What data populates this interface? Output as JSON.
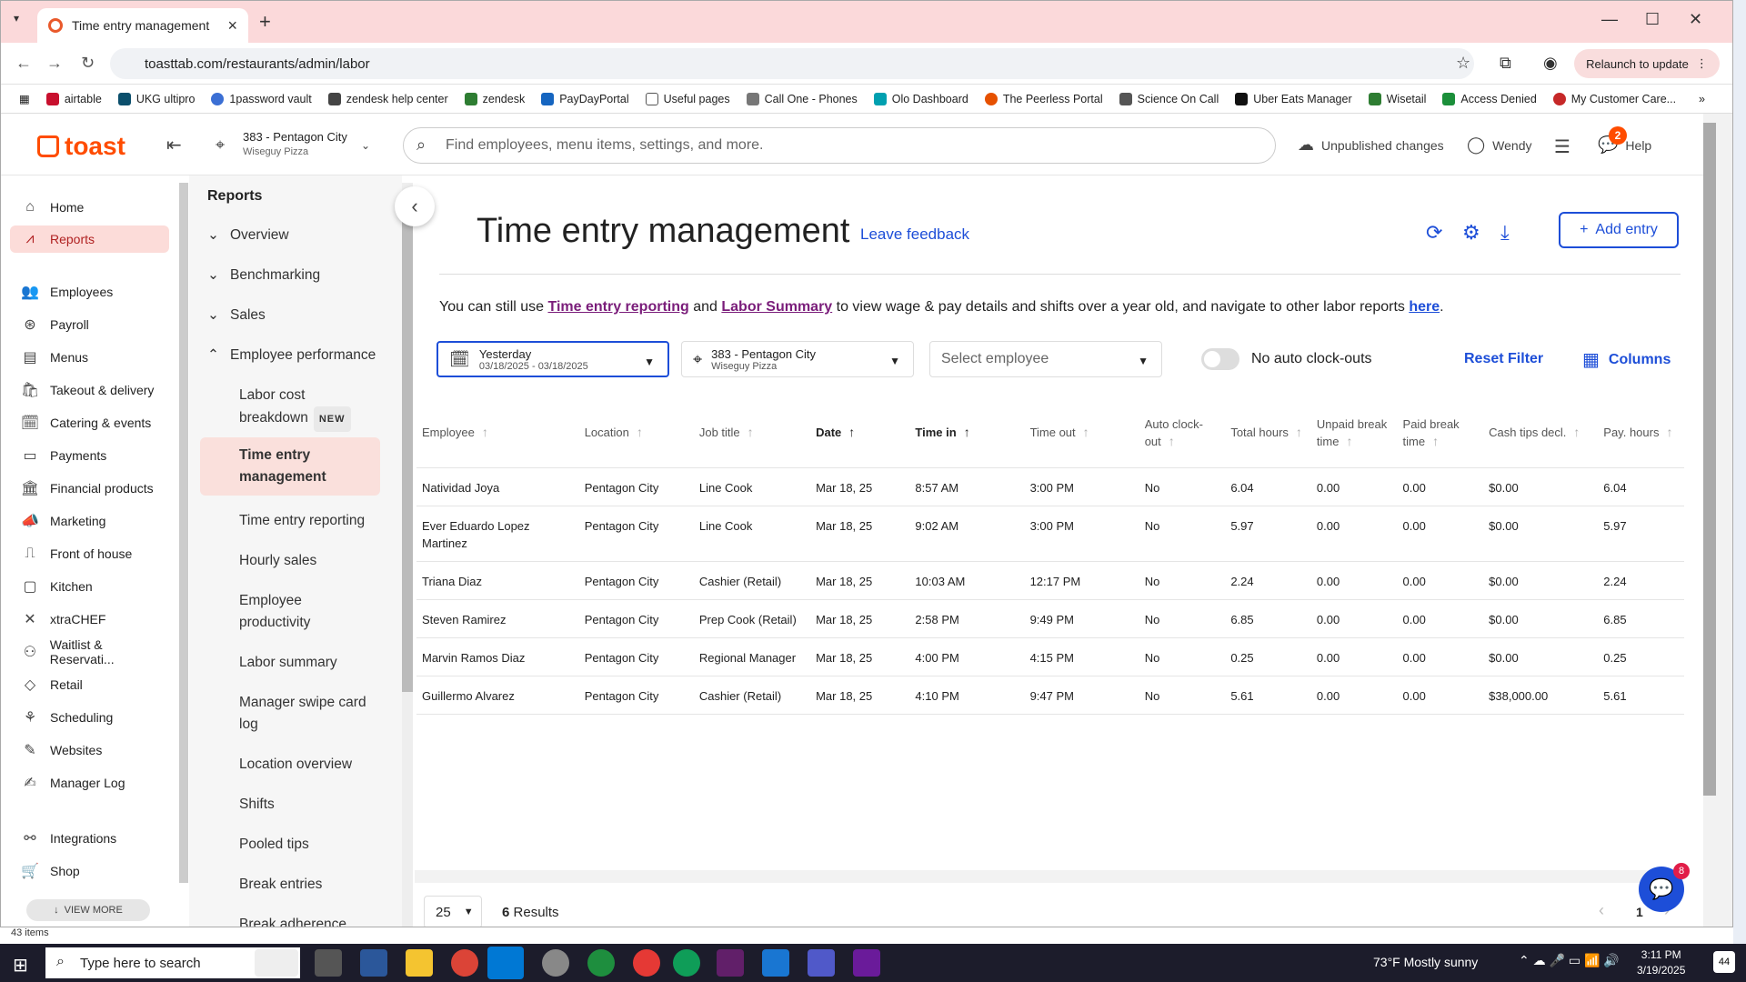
{
  "browser": {
    "tab_title": "Time entry management",
    "url": "toasttab.com/restaurants/admin/labor",
    "relaunch_label": "Relaunch to update",
    "bookmarks": [
      "airtable",
      "UKG ultipro",
      "1password vault",
      "zendesk help center",
      "zendesk",
      "PayDayPortal",
      "Useful pages",
      "Call One - Phones",
      "Olo Dashboard",
      "The Peerless Portal",
      "Science On Call",
      "Uber Eats Manager",
      "Wisetail",
      "Access Denied",
      "My Customer Care..."
    ]
  },
  "app": {
    "logo": "toast",
    "location_name": "383 - Pentagon City",
    "location_sub": "Wiseguy Pizza",
    "search_placeholder": "Find employees, menu items, settings, and more.",
    "unpublished": "Unpublished changes",
    "user": "Wendy",
    "help": "Help",
    "help_badge": "2"
  },
  "sidebar": {
    "items": [
      "Home",
      "Reports",
      "Employees",
      "Payroll",
      "Menus",
      "Takeout & delivery",
      "Catering & events",
      "Payments",
      "Financial products",
      "Marketing",
      "Front of house",
      "Kitchen",
      "xtraCHEF",
      "Waitlist & Reservati...",
      "Retail",
      "Scheduling",
      "Websites",
      "Manager Log",
      "Integrations",
      "Shop"
    ],
    "view_more": "VIEW MORE"
  },
  "subnav": {
    "heading": "Reports",
    "groups": [
      "Overview",
      "Benchmarking",
      "Sales",
      "Employee performance"
    ],
    "items": [
      "Labor cost breakdown",
      "Time entry management",
      "Time entry reporting",
      "Hourly sales",
      "Employee productivity",
      "Labor summary",
      "Manager swipe card log",
      "Location overview",
      "Shifts",
      "Pooled tips",
      "Break entries",
      "Break adherence"
    ],
    "new_badge": "NEW"
  },
  "main": {
    "title": "Time entry management",
    "feedback": "Leave feedback",
    "add_entry": "Add entry",
    "info_pre": "You can still use ",
    "info_link1": "Time entry reporting",
    "info_and": " and ",
    "info_link2": "Labor Summary",
    "info_mid": " to view wage & pay details and shifts over a year old, and navigate to other labor reports ",
    "info_link3": "here",
    "info_end": ".",
    "date_label": "Yesterday",
    "date_range": "03/18/2025 - 03/18/2025",
    "filter_location": "383 - Pentagon City",
    "filter_location_sub": "Wiseguy Pizza",
    "employee_placeholder": "Select employee",
    "toggle_label": "No auto clock-outs",
    "reset": "Reset Filter",
    "columns": "Columns",
    "per_page": "25",
    "results_count": "6",
    "results_label": "Results",
    "page": "1"
  },
  "table": {
    "headers": [
      "Employee",
      "Location",
      "Job title",
      "Date",
      "Time in",
      "Time out",
      "Auto clock-out",
      "Total hours",
      "Unpaid break time",
      "Paid break time",
      "Cash tips decl.",
      "Pay. hours"
    ],
    "rows": [
      [
        "Natividad Joya",
        "Pentagon City",
        "Line Cook",
        "Mar 18, 25",
        "8:57 AM",
        "3:00 PM",
        "No",
        "6.04",
        "0.00",
        "0.00",
        "$0.00",
        "6.04"
      ],
      [
        "Ever Eduardo Lopez Martinez",
        "Pentagon City",
        "Line Cook",
        "Mar 18, 25",
        "9:02 AM",
        "3:00 PM",
        "No",
        "5.97",
        "0.00",
        "0.00",
        "$0.00",
        "5.97"
      ],
      [
        "Triana Diaz",
        "Pentagon City",
        "Cashier (Retail)",
        "Mar 18, 25",
        "10:03 AM",
        "12:17 PM",
        "No",
        "2.24",
        "0.00",
        "0.00",
        "$0.00",
        "2.24"
      ],
      [
        "Steven Ramirez",
        "Pentagon City",
        "Prep Cook (Retail)",
        "Mar 18, 25",
        "2:58 PM",
        "9:49 PM",
        "No",
        "6.85",
        "0.00",
        "0.00",
        "$0.00",
        "6.85"
      ],
      [
        "Marvin Ramos Diaz",
        "Pentagon City",
        "Regional Manager",
        "Mar 18, 25",
        "4:00 PM",
        "4:15 PM",
        "No",
        "0.25",
        "0.00",
        "0.00",
        "$0.00",
        "0.25"
      ],
      [
        "Guillermo Alvarez",
        "Pentagon City",
        "Cashier (Retail)",
        "Mar 18, 25",
        "4:10 PM",
        "9:47 PM",
        "No",
        "5.61",
        "0.00",
        "0.00",
        "$38,000.00",
        "5.61"
      ]
    ]
  },
  "status": {
    "items": "43 items",
    "chat_badge": "8"
  },
  "taskbar": {
    "search": "Type here to search",
    "weather": "73°F  Mostly sunny",
    "time": "3:11 PM",
    "date": "3/19/2025",
    "notif": "44"
  },
  "colors": {
    "brand": "#ff4c00",
    "accent": "#1d4ed8",
    "active_bg": "#fcdcd9"
  }
}
